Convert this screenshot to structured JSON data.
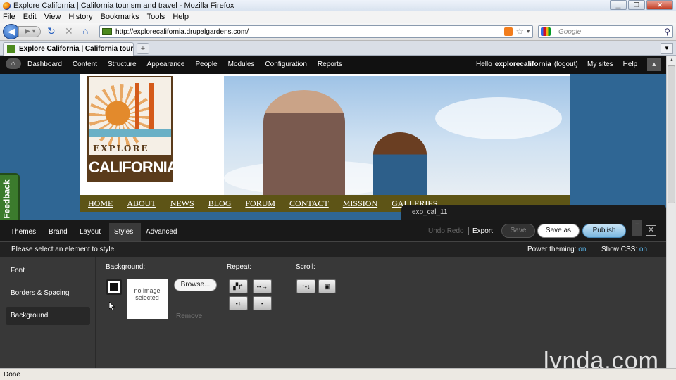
{
  "window": {
    "title": "Explore California | California tourism and travel - Mozilla Firefox"
  },
  "menubar": [
    "File",
    "Edit",
    "View",
    "History",
    "Bookmarks",
    "Tools",
    "Help"
  ],
  "navbar": {
    "url": "http://explorecalifornia.drupalgardens.com/",
    "search_placeholder": "Google"
  },
  "tab": {
    "title": "Explore California | California tourism...",
    "new_tab": "+"
  },
  "admin_toolbar": {
    "home_icon": "house-icon",
    "items": [
      "Dashboard",
      "Content",
      "Structure",
      "Appearance",
      "People",
      "Modules",
      "Configuration",
      "Reports"
    ],
    "hello": "Hello",
    "username": "explorecalifornia",
    "logout": "(logout)",
    "my_sites": "My sites",
    "help": "Help"
  },
  "site": {
    "logo_top": "EXPLORE",
    "logo_bottom": "CALIFORNIA",
    "nav": [
      "HOME",
      "ABOUT",
      "NEWS",
      "BLOG",
      "FORUM",
      "CONTACT",
      "MISSION",
      "GALLERIES"
    ],
    "feedback": "Feedback"
  },
  "themebuilder": {
    "theme_name": "exp_cal_11",
    "tabs": [
      "Themes",
      "Brand",
      "Layout",
      "Styles",
      "Advanced"
    ],
    "active_tab": "Styles",
    "undo": "Undo",
    "redo": "Redo",
    "export": "Export",
    "save": "Save",
    "save_as": "Save as",
    "publish": "Publish",
    "minimize": "−",
    "close": "✕",
    "message": "Please select an element to style.",
    "power_theming_label": "Power theming:",
    "power_theming_value": "on",
    "show_css_label": "Show CSS:",
    "show_css_value": "on",
    "left_nav": [
      "Font",
      "Borders & Spacing",
      "Background"
    ],
    "active_left": "Background",
    "background_label": "Background:",
    "preview_text": "no image selected",
    "browse": "Browse...",
    "remove": "Remove",
    "repeat_label": "Repeat:",
    "scroll_label": "Scroll:"
  },
  "status": {
    "text": "Done"
  },
  "watermark": "lynda.com"
}
